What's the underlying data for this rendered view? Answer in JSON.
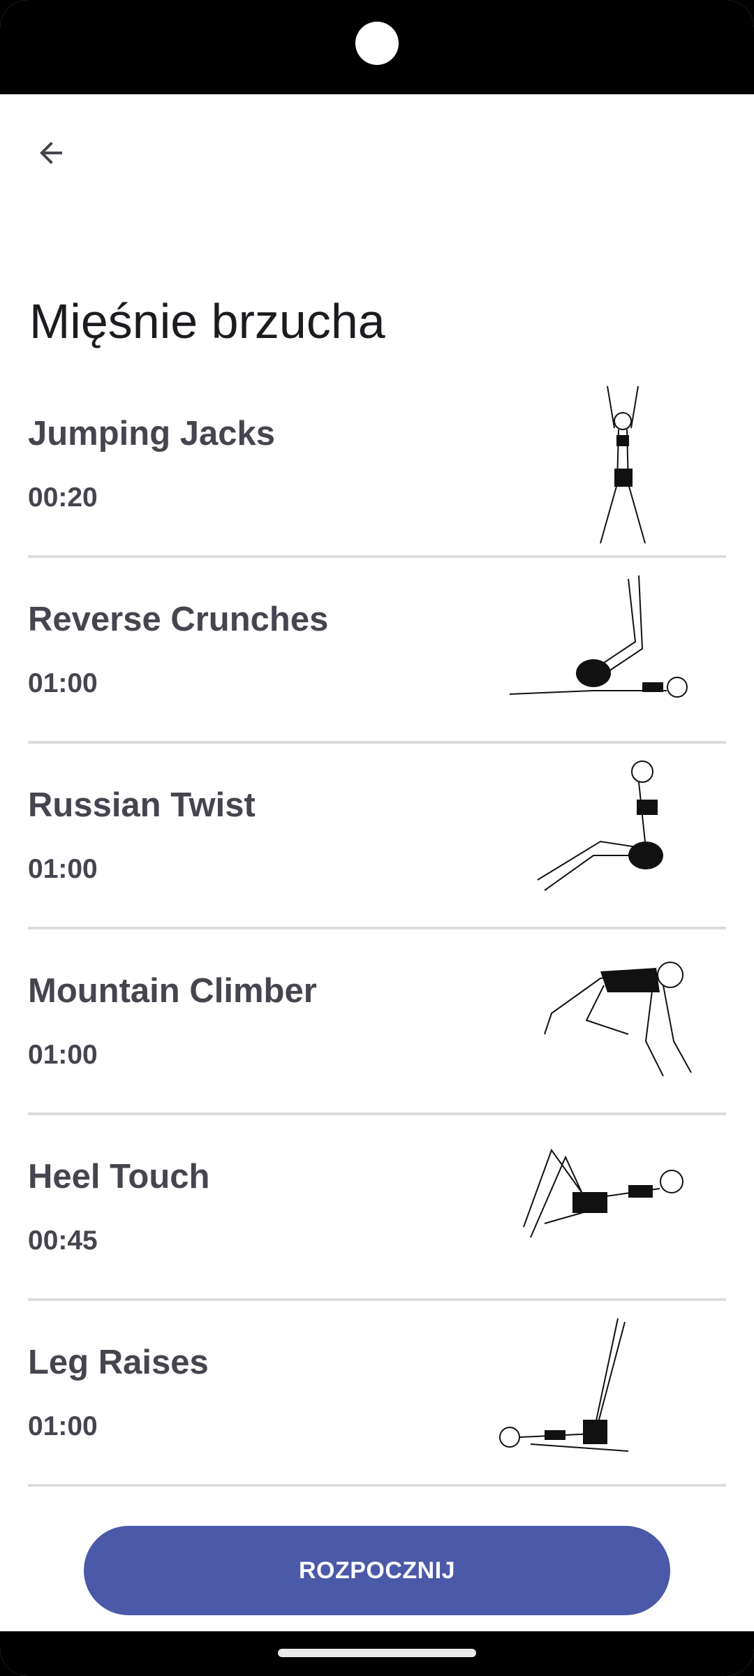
{
  "header": {
    "title": "Mięśnie brzucha",
    "back_icon": "arrow-back-icon"
  },
  "exercises": [
    {
      "name": "Jumping Jacks",
      "duration": "00:20",
      "icon": "jumping-jacks-illustration"
    },
    {
      "name": "Reverse Crunches",
      "duration": "01:00",
      "icon": "reverse-crunches-illustration"
    },
    {
      "name": "Russian Twist",
      "duration": "01:00",
      "icon": "russian-twist-illustration"
    },
    {
      "name": "Mountain Climber",
      "duration": "01:00",
      "icon": "mountain-climber-illustration"
    },
    {
      "name": "Heel Touch",
      "duration": "00:45",
      "icon": "heel-touch-illustration"
    },
    {
      "name": "Leg Raises",
      "duration": "01:00",
      "icon": "leg-raises-illustration"
    }
  ],
  "start_button": {
    "label": "ROZPOCZNIJ"
  },
  "colors": {
    "accent": "#4a59a8",
    "text": "#46444e",
    "title": "#1c1b1f",
    "divider": "#dcdcdc"
  }
}
